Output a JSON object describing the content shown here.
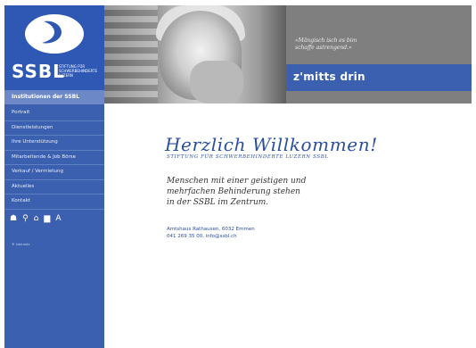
{
  "brand": {
    "name": "SSBL",
    "subtitle_lines": [
      "STIFTUNG FÜR",
      "SCHWERBEHINDERTE",
      "LUZERN"
    ]
  },
  "sidebar": {
    "heading": "Institutionen der SSBL",
    "items": [
      {
        "label": "Portrait"
      },
      {
        "label": "Dienstleistungen"
      },
      {
        "label": "Ihre Unterstützung"
      },
      {
        "label": "Mitarbeitende & Job Börse"
      },
      {
        "label": "Verkauf / Vermietung"
      },
      {
        "label": "Aktuelles"
      },
      {
        "label": "Kontakt"
      }
    ],
    "tools": [
      {
        "icon": "sitemap-icon",
        "glyph": "☗"
      },
      {
        "icon": "search-icon",
        "glyph": "⚲"
      },
      {
        "icon": "home-icon",
        "glyph": "⌂"
      },
      {
        "icon": "print-icon",
        "glyph": "▆"
      },
      {
        "icon": "font-size-icon",
        "glyph": "A"
      }
    ],
    "footnote": "® Internetz"
  },
  "header": {
    "quote_lines": [
      "«Mängisch isch es bim",
      "schaffe astrengend.»"
    ],
    "tagline": "z'mitts drin"
  },
  "main": {
    "title": "Herzlich Willkommen!",
    "subtitle": "STIFTUNG FÜR SCHWERBEHINDERTE LUZERN SSBL",
    "intro_lines": [
      "Menschen mit einer geistigen und",
      "mehrfachen Behinderung stehen",
      "in der SSBL im Zentrum."
    ],
    "address_lines": [
      "Amtshaus Rathausen, 6032 Emmen",
      "041 269 35 00, info@ssbl.ch"
    ]
  },
  "colors": {
    "sidebar": "#3b60b0",
    "accent_text": "#2a4fa0",
    "header_gray": "#7f7f7f"
  }
}
